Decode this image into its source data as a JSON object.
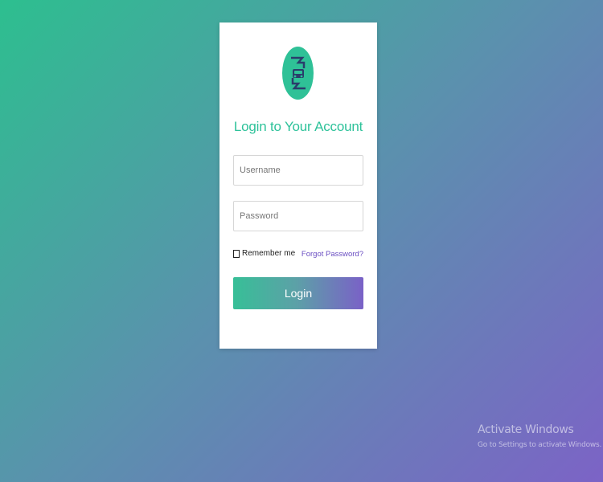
{
  "login": {
    "title": "Login to Your Account",
    "username_placeholder": "Username",
    "password_placeholder": "Password",
    "remember_label": "Remember me",
    "forgot_label": "Forgot Password?",
    "login_label": "Login",
    "logo_icon": "car-service-logo-icon"
  },
  "watermark": {
    "title": "Activate Windows",
    "subtitle": "Go to Settings to activate Windows."
  },
  "colors": {
    "accent": "#2ec29a",
    "link": "#6a4ec2"
  }
}
